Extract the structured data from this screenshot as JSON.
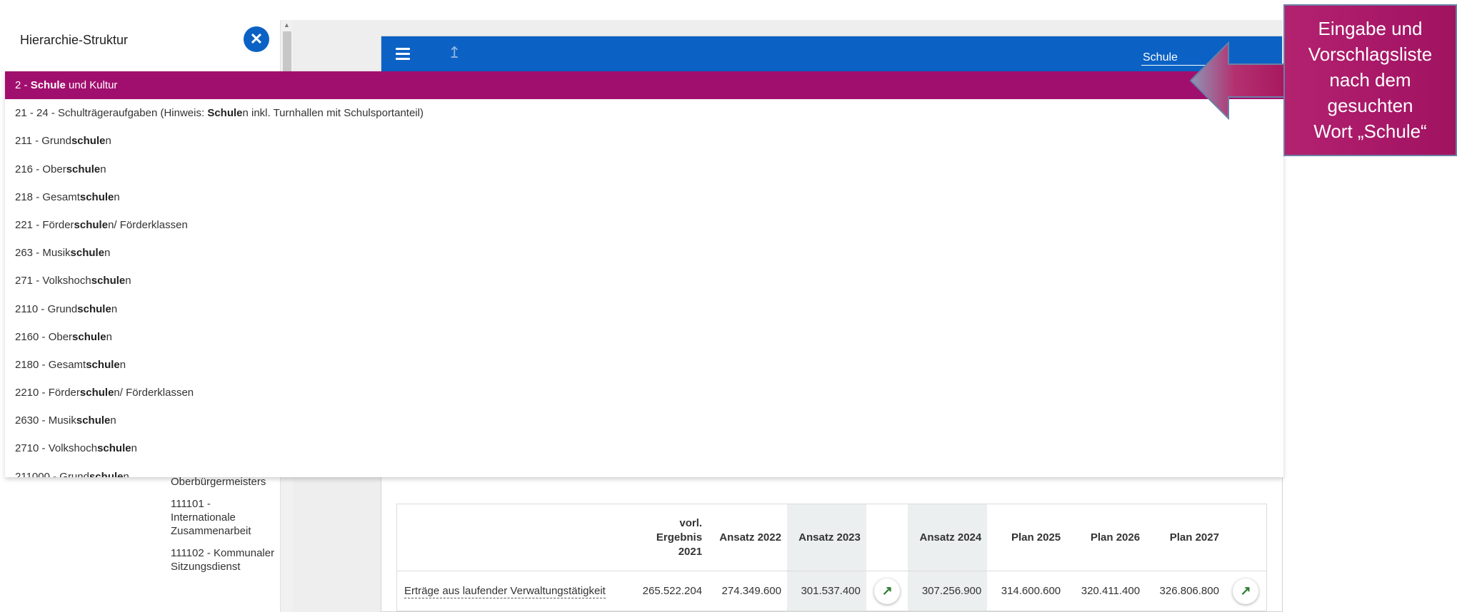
{
  "sidebar": {
    "title": "Hierarchie-Struktur",
    "items": [
      "Oberbürgermeisters",
      "111101 - Internationale Zusammenarbeit",
      "111102 - Kommunaler Sitzungsdienst"
    ]
  },
  "icons": {
    "close": "close-icon",
    "menu": "menu-icon",
    "up": "arrow-up-icon",
    "trend": "trend-up-icon"
  },
  "toolbar": {
    "search_value": "Schule"
  },
  "suggestions": [
    {
      "pre": "2 - ",
      "match": "Schule",
      "post": " und Kultur"
    },
    {
      "pre": "21 - 24 - Schulträgeraufgaben (Hinweis: ",
      "match": "Schule",
      "post": "n inkl. Turnhallen mit Schulsportanteil)"
    },
    {
      "pre": "211 - Grund",
      "match": "schule",
      "post": "n"
    },
    {
      "pre": "216 - Ober",
      "match": "schule",
      "post": "n"
    },
    {
      "pre": "218 - Gesamt",
      "match": "schule",
      "post": "n"
    },
    {
      "pre": "221 - Förder",
      "match": "schule",
      "post": "n/ Förderklassen"
    },
    {
      "pre": "263 - Musik",
      "match": "schule",
      "post": "n"
    },
    {
      "pre": "271 - Volkshoch",
      "match": "schule",
      "post": "n"
    },
    {
      "pre": "2110 - Grund",
      "match": "schule",
      "post": "n"
    },
    {
      "pre": "2160 - Ober",
      "match": "schule",
      "post": "n"
    },
    {
      "pre": "2180 - Gesamt",
      "match": "schule",
      "post": "n"
    },
    {
      "pre": "2210 - Förder",
      "match": "schule",
      "post": "n/ Förderklassen"
    },
    {
      "pre": "2630 - Musik",
      "match": "schule",
      "post": "n"
    },
    {
      "pre": "2710 - Volkshoch",
      "match": "schule",
      "post": "n"
    },
    {
      "pre": "211000 - Grund",
      "match": "schule",
      "post": "n"
    }
  ],
  "table": {
    "headers": [
      "",
      "vorl. Ergebnis 2021",
      "Ansatz 2022",
      "Ansatz 2023",
      "",
      "Ansatz 2024",
      "Plan 2025",
      "Plan 2026",
      "Plan 2027",
      ""
    ],
    "rows": [
      {
        "label": "Erträge aus laufender Verwaltungstätigkeit",
        "v2021": "265.522.204",
        "v2022": "274.349.600",
        "v2023": "301.537.400",
        "v2024": "307.256.900",
        "v2025": "314.600.600",
        "v2026": "320.411.400",
        "v2027": "326.806.800"
      }
    ]
  },
  "callout": {
    "lines": [
      "Eingabe und",
      "Vorschlagsliste",
      "nach dem",
      "gesuchten",
      "Wort „Schule“"
    ]
  },
  "colors": {
    "toolbar": "#0b62c4",
    "active_suggestion": "#a10f6e",
    "callout": "#a61666"
  }
}
